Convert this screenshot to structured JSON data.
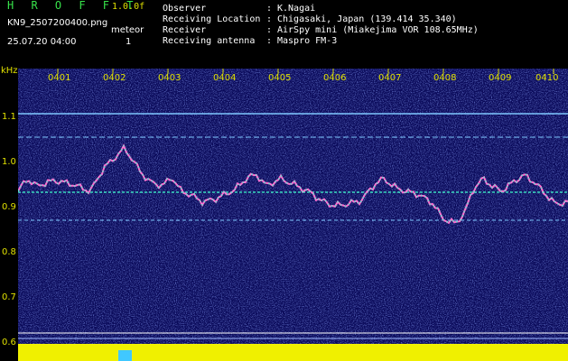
{
  "header": {
    "app_title": "H R O F F T",
    "version": "1.0.0f",
    "filename": "KN9_2507200400.png",
    "timestamp": "25.07.20 04:00",
    "meteor_label": "meteor",
    "meteor_count": "1"
  },
  "meta": [
    {
      "key": "Observer",
      "value": "K.Nagai"
    },
    {
      "key": "Receiving Location",
      "value": "Chigasaki, Japan (139.414 35.340)"
    },
    {
      "key": "Receiver",
      "value": "AirSpy mini (Miakejima VOR 108.65MHz)"
    },
    {
      "key": "Receiving antenna",
      "value": "Maspro FM-3"
    }
  ],
  "axis": {
    "unit": "kHz",
    "y_ticks": [
      "1.1",
      "1.0",
      "0.9",
      "0.8",
      "0.7",
      "0.6"
    ],
    "x_ticks": [
      "0401",
      "0402",
      "0403",
      "0404",
      "0405",
      "0406",
      "0407",
      "0408",
      "0409",
      "0410"
    ]
  },
  "colors": {
    "background": "#000000",
    "plot_background": "#0a0a5a",
    "noise": "#2d3fb8",
    "title_green": "#37e24a",
    "label_yellow": "#e0e000",
    "signal_pink": "#ff6fd0",
    "signal_cyan": "#40ffd0",
    "carrier_line": "#7fc8ff",
    "level_bar": "#f0f000",
    "meteor_marker": "#40c8ff"
  }
}
